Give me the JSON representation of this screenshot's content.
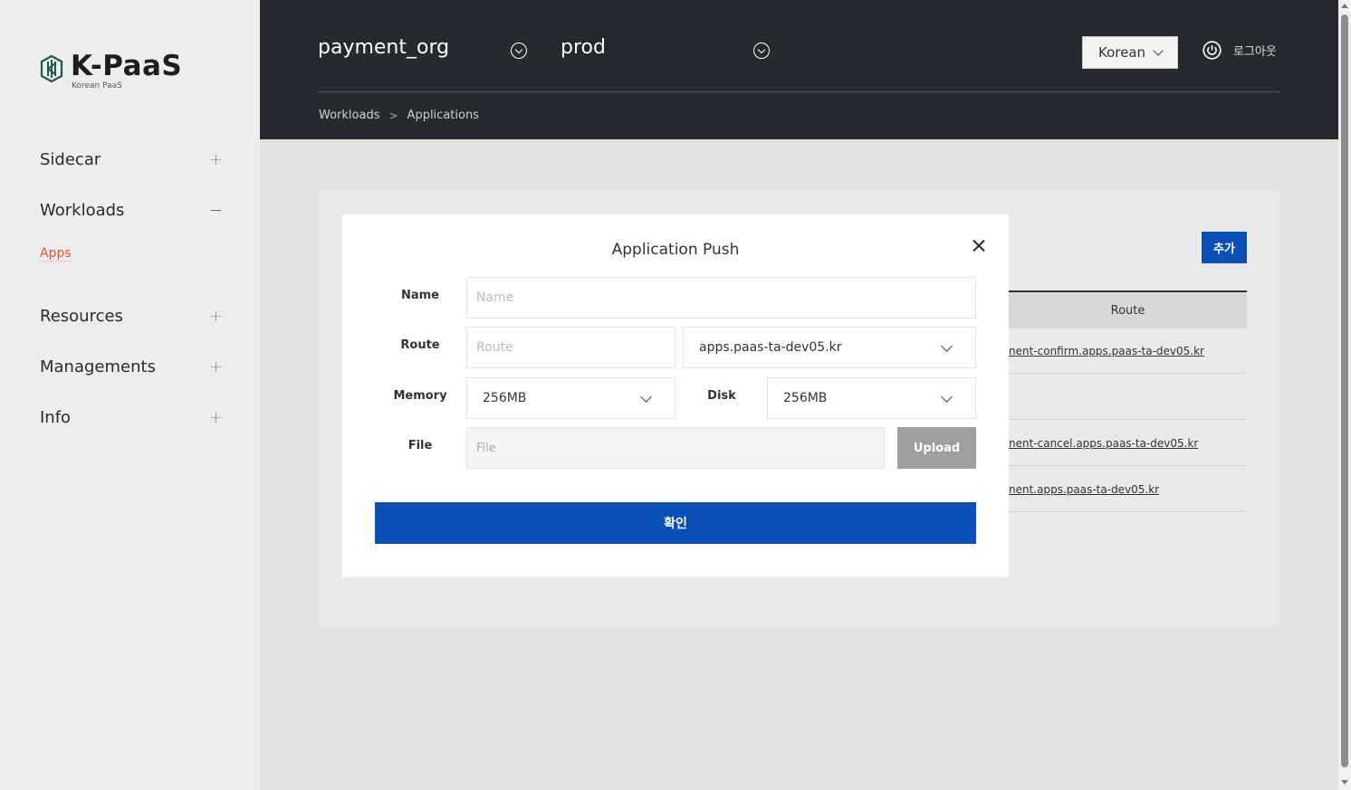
{
  "sidebar": {
    "logo_text": "K-PaaS",
    "logo_subtitle": "Korean PaaS",
    "items": [
      {
        "label": "Sidecar",
        "toggle": "+"
      },
      {
        "label": "Workloads",
        "toggle": "−"
      },
      {
        "label": "Resources",
        "toggle": "+"
      },
      {
        "label": "Managements",
        "toggle": "+"
      },
      {
        "label": "Info",
        "toggle": "+"
      }
    ],
    "sub_item": "Apps"
  },
  "header": {
    "org": "payment_org",
    "space": "prod",
    "language": "Korean",
    "logout_label": "로그아웃",
    "breadcrumb": [
      "Workloads",
      "Applications"
    ],
    "breadcrumb_separator": ">"
  },
  "background": {
    "add_button_label": "추가",
    "table_header_route": "Route",
    "rows": [
      "nent-confirm.apps.paas-ta-dev05.kr",
      "",
      "nent-cancel.apps.paas-ta-dev05.kr",
      "nent.apps.paas-ta-dev05.kr"
    ]
  },
  "modal": {
    "title": "Application Push",
    "name_label": "Name",
    "name_placeholder": "Name",
    "route_label": "Route",
    "route_placeholder": "Route",
    "domain_value": "apps.paas-ta-dev05.kr",
    "memory_label": "Memory",
    "memory_value": "256MB",
    "disk_label": "Disk",
    "disk_value": "256MB",
    "file_label": "File",
    "file_placeholder": "File",
    "upload_label": "Upload",
    "confirm_label": "확인"
  },
  "colors": {
    "header_bg": "#262930",
    "primary": "#0a4fb6",
    "active_nav": "#e0542c",
    "sidebar_bg": "#ededed"
  }
}
